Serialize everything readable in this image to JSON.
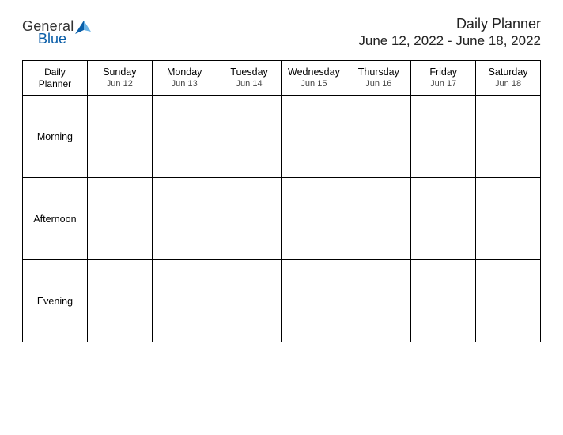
{
  "logo": {
    "word1": "General",
    "word2": "Blue"
  },
  "header": {
    "title": "Daily Planner",
    "dateRange": "June 12, 2022 - June 18, 2022"
  },
  "table": {
    "cornerLine1": "Daily",
    "cornerLine2": "Planner",
    "days": [
      {
        "name": "Sunday",
        "date": "Jun 12"
      },
      {
        "name": "Monday",
        "date": "Jun 13"
      },
      {
        "name": "Tuesday",
        "date": "Jun 14"
      },
      {
        "name": "Wednesday",
        "date": "Jun 15"
      },
      {
        "name": "Thursday",
        "date": "Jun 16"
      },
      {
        "name": "Friday",
        "date": "Jun 17"
      },
      {
        "name": "Saturday",
        "date": "Jun 18"
      }
    ],
    "rows": [
      {
        "label": "Morning"
      },
      {
        "label": "Afternoon"
      },
      {
        "label": "Evening"
      }
    ]
  }
}
